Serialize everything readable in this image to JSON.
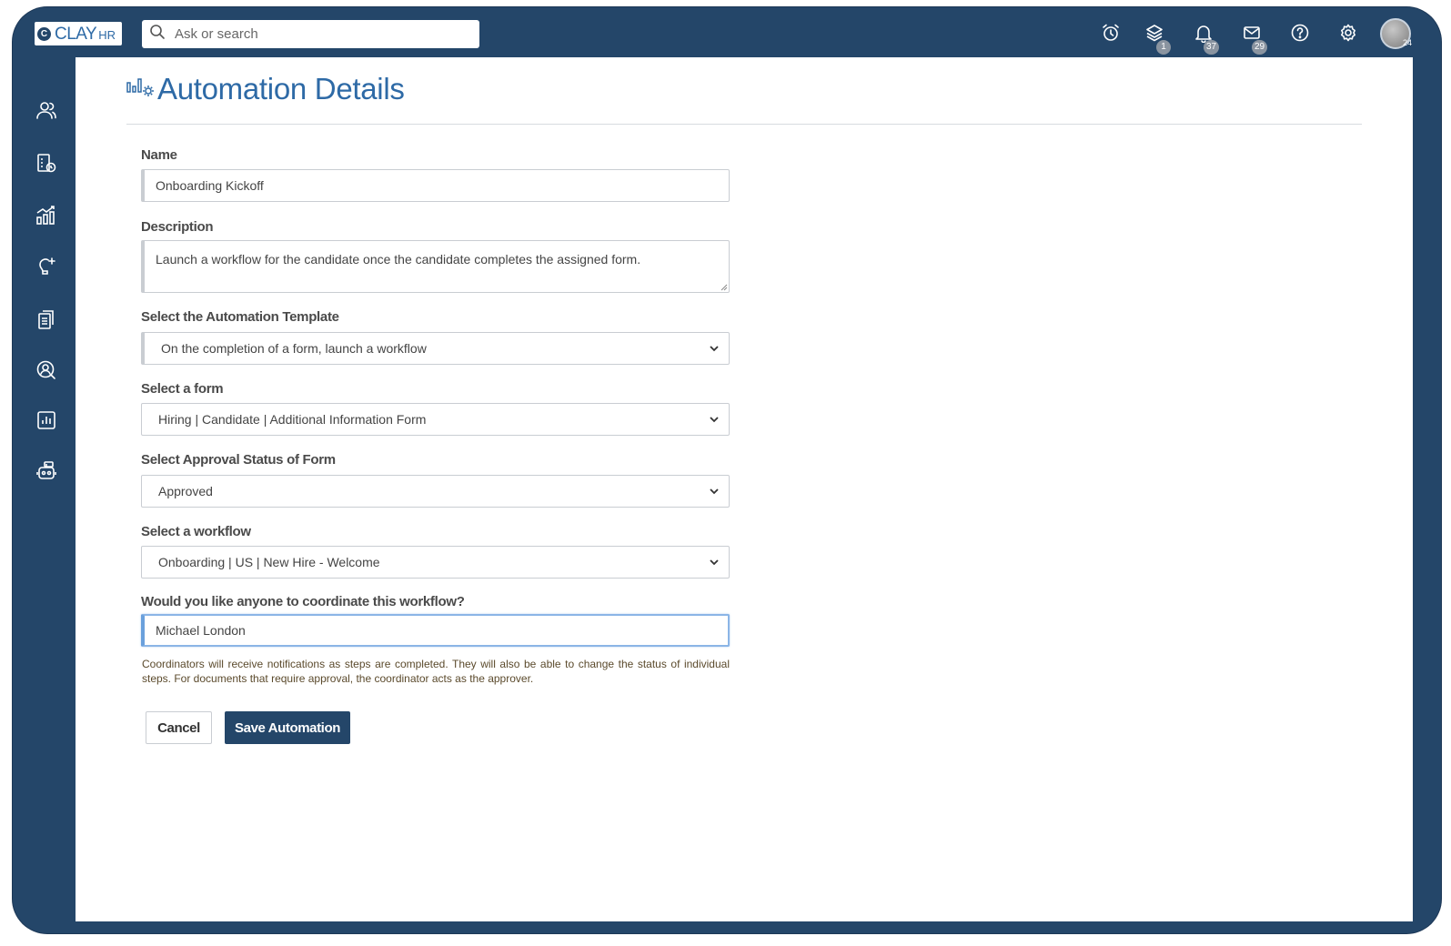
{
  "brand": {
    "name": "CLAY",
    "suffix": "HR",
    "mark": "C"
  },
  "search": {
    "placeholder": "Ask or search"
  },
  "topbar": {
    "icons": [
      {
        "name": "alarm-clock-icon"
      },
      {
        "name": "layers-icon",
        "badge": "1"
      },
      {
        "name": "bell-icon",
        "badge": "37"
      },
      {
        "name": "mail-icon",
        "badge": "29"
      },
      {
        "name": "help-icon"
      },
      {
        "name": "gear-icon"
      }
    ],
    "avatar_badge": "24"
  },
  "sidebar": {
    "items": [
      {
        "name": "people-icon"
      },
      {
        "name": "document-clock-icon"
      },
      {
        "name": "bar-chart-growth-icon"
      },
      {
        "name": "lightbulb-icon"
      },
      {
        "name": "documents-icon"
      },
      {
        "name": "user-search-icon"
      },
      {
        "name": "report-icon"
      },
      {
        "name": "robot-icon"
      }
    ]
  },
  "page": {
    "title": "Automation Details"
  },
  "form": {
    "name_label": "Name",
    "name_value": "Onboarding Kickoff",
    "description_label": "Description",
    "description_value": "Launch a workflow for the candidate once the candidate completes the assigned form.",
    "template_label": "Select the Automation Template",
    "template_value": "On the completion of a form, launch a workflow",
    "form_label": "Select a form",
    "form_value": "Hiring | Candidate | Additional Information Form",
    "approval_label": "Select Approval Status of Form",
    "approval_value": "Approved",
    "workflow_label": "Select a workflow",
    "workflow_value": "Onboarding | US | New Hire - Welcome",
    "coordinator_label": "Would you like anyone to coordinate this workflow?",
    "coordinator_value": "Michael London",
    "coordinator_help": "Coordinators will receive notifications as steps are completed. They will also be able to change the status of individual steps. For documents that require approval, the coordinator acts as the approver."
  },
  "actions": {
    "cancel_label": "Cancel",
    "save_label": "Save Automation"
  },
  "colors": {
    "navy": "#244669",
    "title_blue": "#2e6aa6",
    "focus_blue": "#6aa0dc"
  }
}
